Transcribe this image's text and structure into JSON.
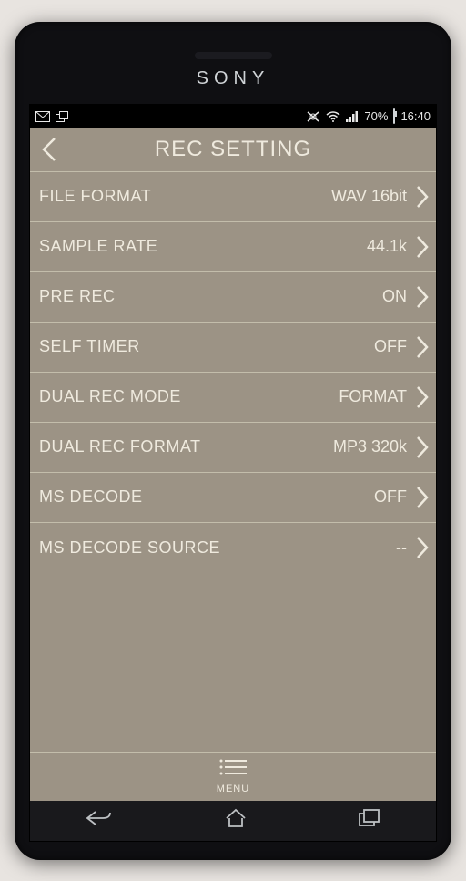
{
  "brand": "SONY",
  "status": {
    "battery_pct": "70%",
    "time": "16:40"
  },
  "app": {
    "title": "REC SETTING",
    "menu_label": "MENU"
  },
  "settings": [
    {
      "label": "FILE FORMAT",
      "value": "WAV 16bit"
    },
    {
      "label": "SAMPLE RATE",
      "value": "44.1k"
    },
    {
      "label": "PRE REC",
      "value": "ON"
    },
    {
      "label": "SELF TIMER",
      "value": "OFF"
    },
    {
      "label": "DUAL REC MODE",
      "value": "FORMAT"
    },
    {
      "label": "DUAL REC FORMAT",
      "value": "MP3 320k"
    },
    {
      "label": "MS DECODE",
      "value": "OFF"
    },
    {
      "label": "MS DECODE SOURCE",
      "value": "--"
    }
  ]
}
